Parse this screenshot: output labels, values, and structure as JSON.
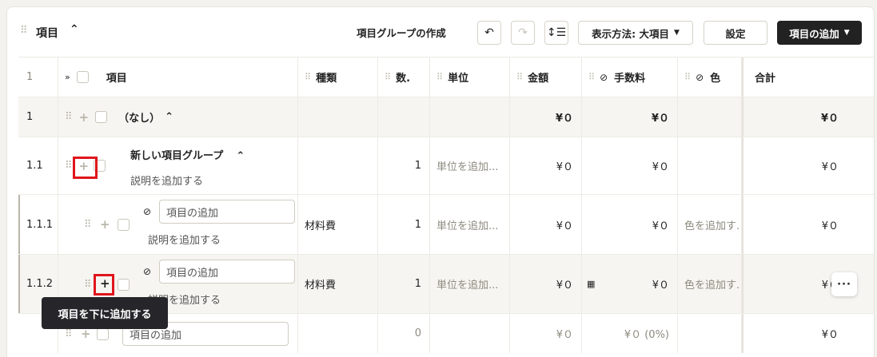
{
  "header": {
    "title": "項目",
    "create_group": "項目グループの作成",
    "view_mode": "表示方法: 大項目",
    "settings": "設定",
    "add_item": "項目の追加"
  },
  "columns": {
    "index": "1",
    "item": "項目",
    "type": "種類",
    "qty": "数.",
    "unit": "単位",
    "amount": "金額",
    "fee": "手数料",
    "color": "色",
    "total": "合計"
  },
  "rows": [
    {
      "index": "1",
      "label": "（なし）",
      "amount": "¥０",
      "fee": "¥０",
      "total": "¥０"
    },
    {
      "index": "1.1",
      "label": "新しい項目グループ",
      "desc": "説明を追加する",
      "qty": "1",
      "unit": "単位を追加...",
      "amount": "¥０",
      "fee": "¥０",
      "total": "¥０"
    },
    {
      "index": "1.1.1",
      "input": "項目の追加",
      "desc": "説明を追加する",
      "type": "材料費",
      "qty": "1",
      "unit": "単位を追加...",
      "amount": "¥０",
      "fee": "¥０",
      "color": "色を追加す.",
      "total": "¥０"
    },
    {
      "index": "1.1.2",
      "input": "項目の追加",
      "desc": "説明を追加する",
      "type": "材料費",
      "qty": "1",
      "unit": "単位を追加...",
      "amount": "¥０",
      "fee": "¥０",
      "color": "色を追加す.",
      "total": "¥０"
    },
    {
      "input": "項目の追加",
      "qty": "0",
      "amount": "¥０",
      "fee": "¥０ (0%)",
      "total": "¥０"
    }
  ],
  "tooltip": "項目を下に追加する"
}
